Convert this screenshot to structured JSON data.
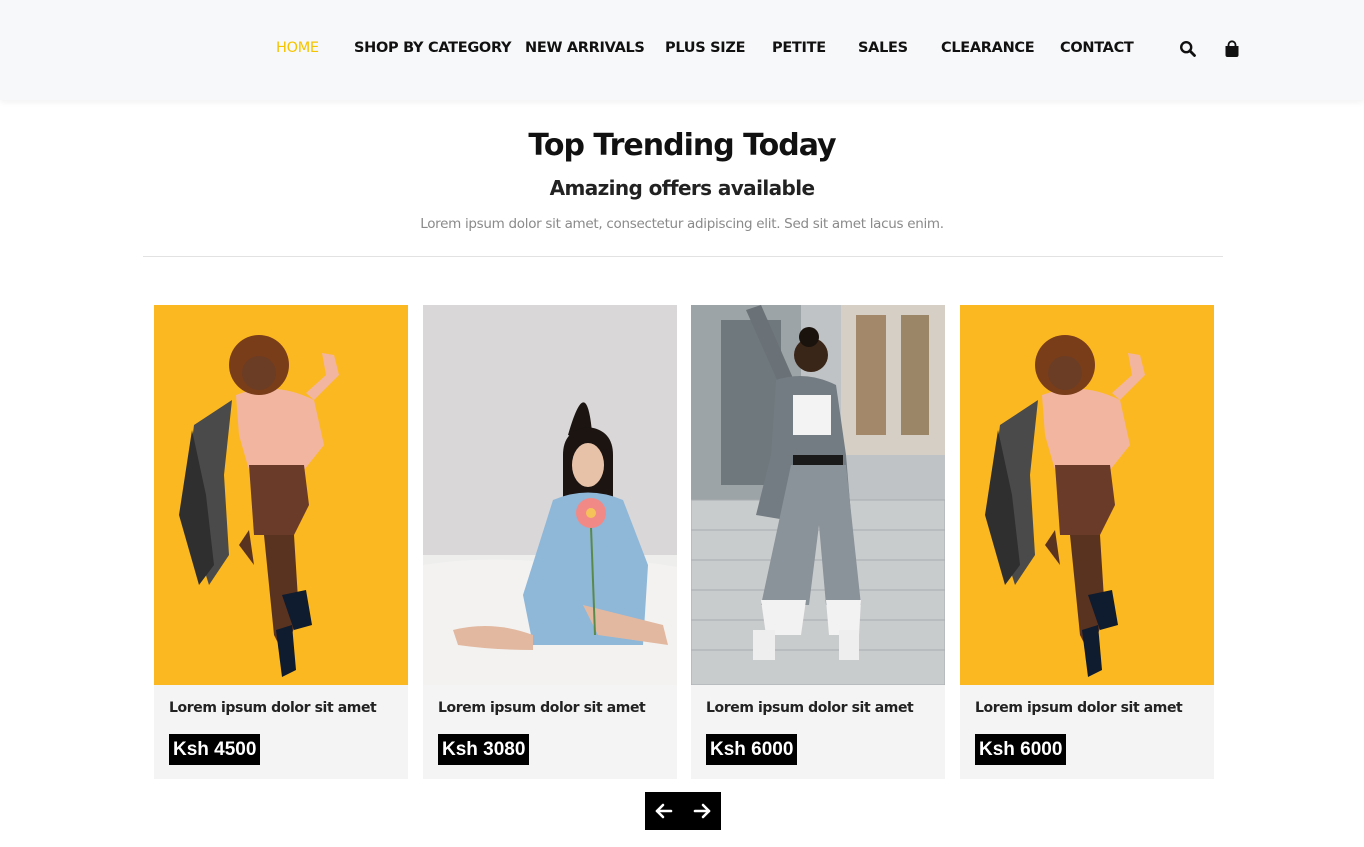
{
  "nav": {
    "items": [
      {
        "label": "HOME",
        "active": true
      },
      {
        "label": "SHOP BY CATEGORY",
        "active": false
      },
      {
        "label": "NEW ARRIVALS",
        "active": false
      },
      {
        "label": "PLUS SIZE",
        "active": false
      },
      {
        "label": "PETITE",
        "active": false
      },
      {
        "label": "SALES",
        "active": false
      },
      {
        "label": "CLEARANCE",
        "active": false
      },
      {
        "label": "CONTACT",
        "active": false
      }
    ],
    "icons": [
      "search-icon",
      "shopping-bag-icon"
    ],
    "active_color": "#f5c400"
  },
  "section": {
    "title": "Top Trending Today",
    "subtitle": "Amazing offers available",
    "lead": "Lorem ipsum dolor sit amet, consectetur adipiscing elit. Sed sit amet lacus enim."
  },
  "products": [
    {
      "title": "Lorem ipsum dolor sit amet",
      "price": "Ksh 4500",
      "image": "woman-yellow-backdrop-photo"
    },
    {
      "title": "Lorem ipsum dolor sit amet",
      "price": "Ksh 3080",
      "image": "woman-blue-dress-flower-photo"
    },
    {
      "title": "Lorem ipsum dolor sit amet",
      "price": "Ksh 6000",
      "image": "woman-grey-suit-stairs-photo"
    },
    {
      "title": "Lorem ipsum dolor sit amet",
      "price": "Ksh 6000",
      "image": "woman-yellow-backdrop-photo"
    }
  ],
  "carousel": {
    "controls": [
      "arrow-left-icon",
      "arrow-right-icon"
    ]
  },
  "colors": {
    "header_bg": "#f7f8f9",
    "accent": "#f5c400",
    "price_bg": "#000000",
    "card_bg": "#f4f4f4"
  }
}
